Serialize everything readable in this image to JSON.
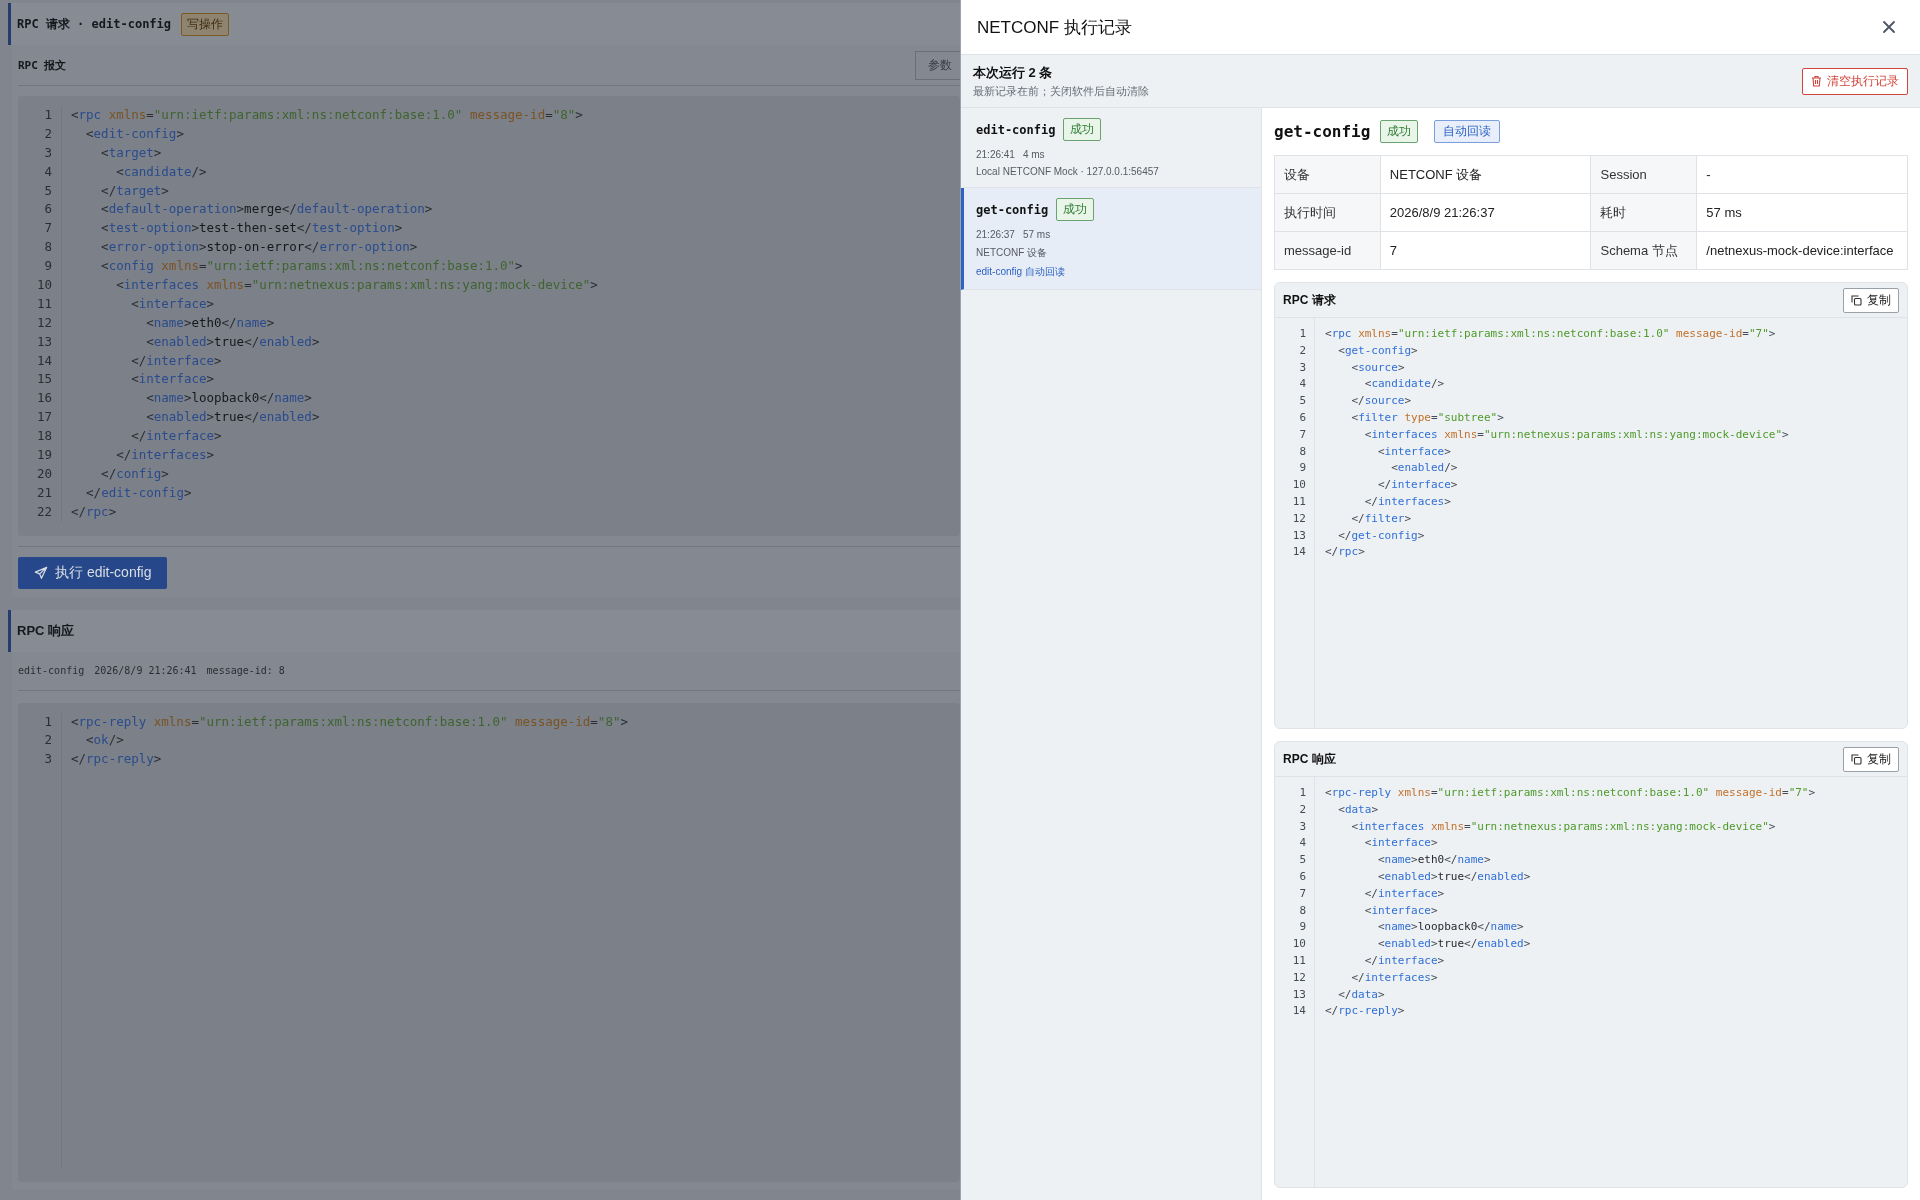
{
  "page": {
    "header": {
      "title": "RPC 请求 · edit-config",
      "badge": "写操作"
    },
    "request": {
      "title": "RPC 报文",
      "params_button": "参数",
      "lines": [
        {
          "no": "1",
          "text": "<rpc xmlns=\"urn:ietf:params:xml:ns:netconf:base:1.0\" message-id=\"8\">"
        },
        {
          "no": "2",
          "text": "  <edit-config>"
        },
        {
          "no": "3",
          "text": "    <target>"
        },
        {
          "no": "4",
          "text": "      <candidate/>"
        },
        {
          "no": "5",
          "text": "    </target>"
        },
        {
          "no": "6",
          "text": "    <default-operation>merge</default-operation>"
        },
        {
          "no": "7",
          "text": "    <test-option>test-then-set</test-option>"
        },
        {
          "no": "8",
          "text": "    <error-option>stop-on-error</error-option>"
        },
        {
          "no": "9",
          "text": "    <config xmlns=\"urn:ietf:params:xml:ns:netconf:base:1.0\">"
        },
        {
          "no": "10",
          "text": "      <interfaces xmlns=\"urn:netnexus:params:xml:ns:yang:mock-device\">"
        },
        {
          "no": "11",
          "text": "        <interface>"
        },
        {
          "no": "12",
          "text": "          <name>eth0</name>"
        },
        {
          "no": "13",
          "text": "          <enabled>true</enabled>"
        },
        {
          "no": "14",
          "text": "        </interface>"
        },
        {
          "no": "15",
          "text": "        <interface>"
        },
        {
          "no": "16",
          "text": "          <name>loopback0</name>"
        },
        {
          "no": "17",
          "text": "          <enabled>true</enabled>"
        },
        {
          "no": "18",
          "text": "        </interface>"
        },
        {
          "no": "19",
          "text": "      </interfaces>"
        },
        {
          "no": "20",
          "text": "    </config>"
        },
        {
          "no": "21",
          "text": "  </edit-config>"
        },
        {
          "no": "22",
          "text": "</rpc>"
        }
      ]
    },
    "execute_button": "执行 edit-config",
    "response": {
      "title": "RPC 响应",
      "meta": [
        "edit-config",
        "2026/8/9 21:26:41",
        "message-id: 8"
      ],
      "lines": [
        {
          "no": "1",
          "text": "<rpc-reply xmlns=\"urn:ietf:params:xml:ns:netconf:base:1.0\" message-id=\"8\">"
        },
        {
          "no": "2",
          "text": "  <ok/>"
        },
        {
          "no": "3",
          "text": "</rpc-reply>"
        }
      ]
    }
  },
  "drawer": {
    "title": "NETCONF 执行记录",
    "summary": {
      "title": "本次运行 2 条",
      "subtitle": "最新记录在前；关闭软件后自动清除"
    },
    "clear_button": "清空执行记录",
    "records": [
      {
        "op": "edit-config",
        "status": "成功",
        "time": "21:26:41",
        "duration": "4 ms",
        "device": "Local NETCONF Mock · 127.0.0.1:56457",
        "selected": false
      },
      {
        "op": "get-config",
        "status": "成功",
        "time": "21:26:37",
        "duration": "57 ms",
        "device": "NETCONF 设备",
        "note": "edit-config 自动回读",
        "selected": true
      }
    ],
    "detail": {
      "op": "get-config",
      "status": "成功",
      "tag": "自动回读",
      "fields": [
        [
          {
            "label": "设备",
            "value": "NETCONF 设备"
          },
          {
            "label": "Session",
            "value": "-"
          }
        ],
        [
          {
            "label": "执行时间",
            "value": "2026/8/9 21:26:37"
          },
          {
            "label": "耗时",
            "value": "57 ms"
          }
        ],
        [
          {
            "label": "message-id",
            "value": "7"
          },
          {
            "label": "Schema 节点",
            "value": "/netnexus-mock-device:interface"
          }
        ]
      ],
      "request": {
        "title": "RPC 请求",
        "copy": "复制",
        "lines": [
          {
            "no": "1",
            "text": "<rpc xmlns=\"urn:ietf:params:xml:ns:netconf:base:1.0\" message-id=\"7\">"
          },
          {
            "no": "2",
            "text": "  <get-config>"
          },
          {
            "no": "3",
            "text": "    <source>"
          },
          {
            "no": "4",
            "text": "      <candidate/>"
          },
          {
            "no": "5",
            "text": "    </source>"
          },
          {
            "no": "6",
            "text": "    <filter type=\"subtree\">"
          },
          {
            "no": "7",
            "text": "      <interfaces xmlns=\"urn:netnexus:params:xml:ns:yang:mock-device\">"
          },
          {
            "no": "8",
            "text": "        <interface>"
          },
          {
            "no": "9",
            "text": "          <enabled/>"
          },
          {
            "no": "10",
            "text": "        </interface>"
          },
          {
            "no": "11",
            "text": "      </interfaces>"
          },
          {
            "no": "12",
            "text": "    </filter>"
          },
          {
            "no": "13",
            "text": "  </get-config>"
          },
          {
            "no": "14",
            "text": "</rpc>"
          }
        ]
      },
      "response": {
        "title": "RPC 响应",
        "copy": "复制",
        "lines": [
          {
            "no": "1",
            "text": "<rpc-reply xmlns=\"urn:ietf:params:xml:ns:netconf:base:1.0\" message-id=\"7\">"
          },
          {
            "no": "2",
            "text": "  <data>"
          },
          {
            "no": "3",
            "text": "    <interfaces xmlns=\"urn:netnexus:params:xml:ns:yang:mock-device\">"
          },
          {
            "no": "4",
            "text": "      <interface>"
          },
          {
            "no": "5",
            "text": "        <name>eth0</name>"
          },
          {
            "no": "6",
            "text": "        <enabled>true</enabled>"
          },
          {
            "no": "7",
            "text": "      </interface>"
          },
          {
            "no": "8",
            "text": "      <interface>"
          },
          {
            "no": "9",
            "text": "        <name>loopback0</name>"
          },
          {
            "no": "10",
            "text": "        <enabled>true</enabled>"
          },
          {
            "no": "11",
            "text": "      </interface>"
          },
          {
            "no": "12",
            "text": "    </interfaces>"
          },
          {
            "no": "13",
            "text": "  </data>"
          },
          {
            "no": "14",
            "text": "</rpc-reply>"
          }
        ]
      }
    }
  }
}
